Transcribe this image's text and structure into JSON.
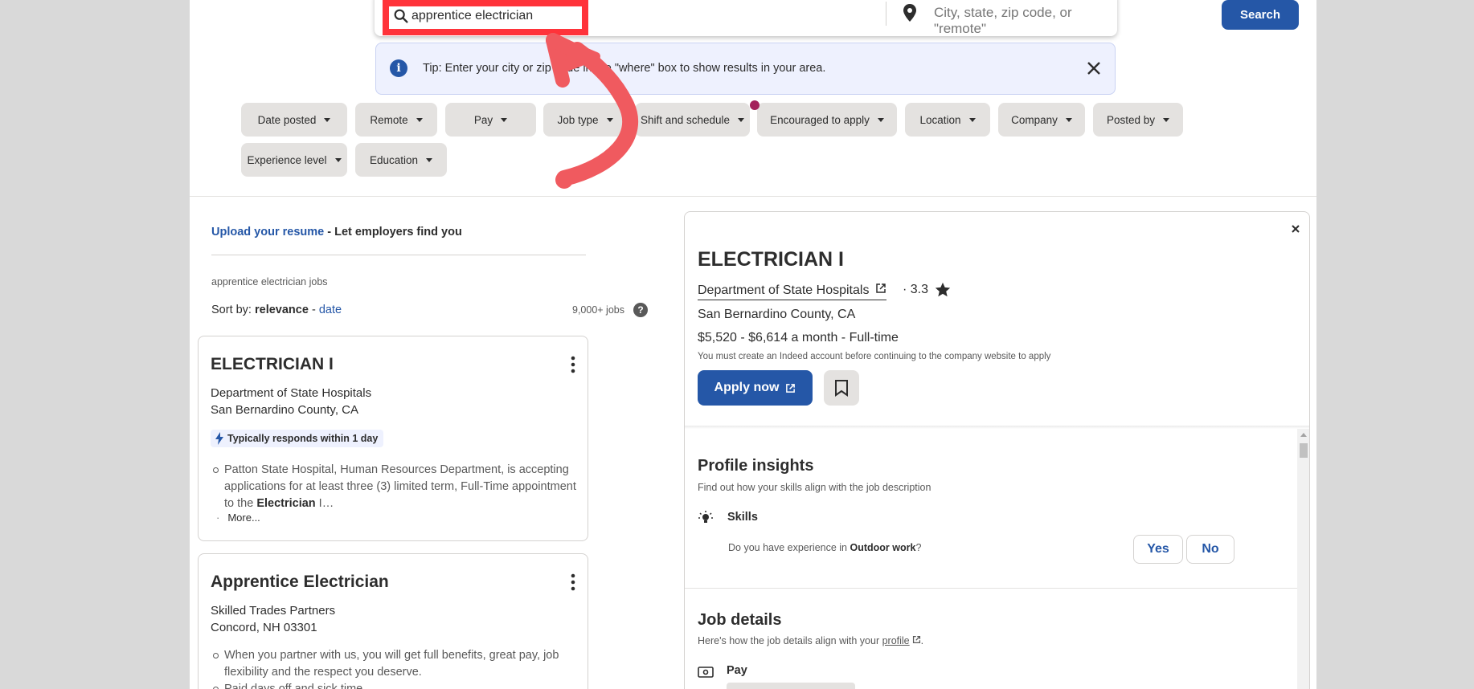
{
  "search": {
    "what_value": "apprentice electrician",
    "where_placeholder": "City, state, zip code, or \"remote\"",
    "search_label": "Search"
  },
  "tip": {
    "text": "Tip: Enter your city or zip code in the \"where\" box to show results in your area."
  },
  "filters": [
    "Date posted",
    "Remote",
    "Pay",
    "Job type",
    "Shift and schedule",
    "Encouraged to apply",
    "Location",
    "Company",
    "Posted by",
    "Experience level",
    "Education"
  ],
  "left": {
    "upload_link": "Upload your resume",
    "upload_rest": " - Let employers find you",
    "jobs_caption": "apprentice electrician jobs",
    "sort_prefix": "Sort by: ",
    "sort_relevance": "relevance",
    "sort_sep": " - ",
    "sort_date": "date",
    "job_count": "9,000+ jobs",
    "help_symbol": "?"
  },
  "cards": [
    {
      "title": "ELECTRICIAN I",
      "company": "Department of State Hospitals",
      "location": "San Bernardino County, CA",
      "badge": "Typically responds within 1 day",
      "snippet_pre": "Patton State Hospital, Human Resources Department, is accepting applications for at least three (3) limited term, Full-Time appointment to the ",
      "snippet_bold": "Electrician",
      "snippet_post": " I…",
      "more_dot": "·",
      "more": "More..."
    },
    {
      "title": "Apprentice Electrician",
      "company": "Skilled Trades Partners",
      "location": "Concord, NH 03301",
      "snippet_1": "When you partner with us, you will get full benefits, great pay, job flexibility and the respect you deserve.",
      "snippet_2": "Paid days off and sick time."
    }
  ],
  "detail": {
    "title": "ELECTRICIAN I",
    "company": "Department of State Hospitals",
    "rating": "· 3.3",
    "location": "San Bernardino County, CA",
    "salary": "$5,520 - $6,614 a month  - Full-time",
    "note": "You must create an Indeed account before continuing to the company website to apply",
    "apply_label": "Apply now",
    "profile_insights_title": "Profile insights",
    "profile_insights_sub": "Find out how your skills align with the job description",
    "skills_label": "Skills",
    "question_pre": "Do you have experience in ",
    "question_bold": "Outdoor work",
    "question_post": "?",
    "yes_label": "Yes",
    "no_label": "No",
    "job_details_title": "Job details",
    "job_details_sub_pre": "Here's how the job details align with your ",
    "job_details_sub_link": "profile",
    "job_details_sub_post": ".",
    "pay_label": "Pay"
  },
  "colors": {
    "brand_blue": "#2557a7",
    "annotation_red": "#ff333a",
    "annotation_arrow": "#f05a5f",
    "notification_dot": "#a3225b"
  }
}
